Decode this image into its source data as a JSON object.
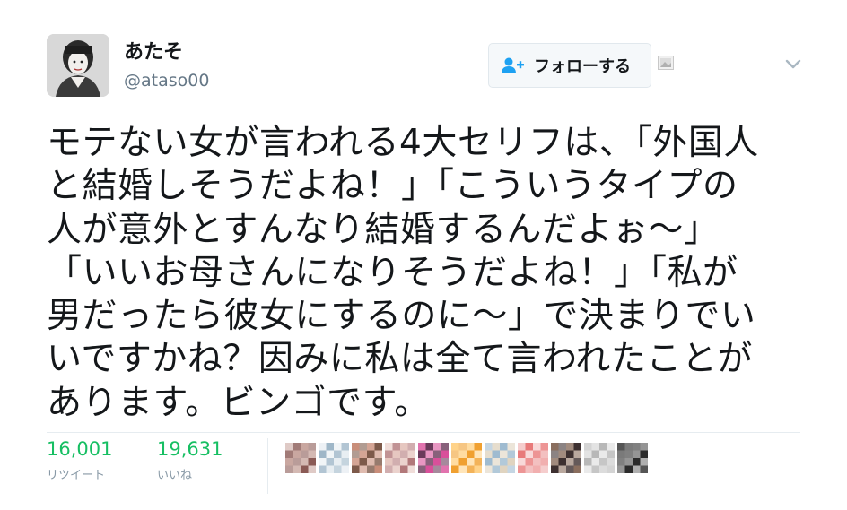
{
  "tweet": {
    "author_name": "あたそ",
    "author_handle": "@ataso00",
    "follow_label": "フォローする",
    "text": "モテない女が言われる4大セリフは、「外国人\nと結婚しそうだよね！」「こういうタイプの\n人が意外とすんなり結婚するんだよぉ～」\n「いいお母さんになりそうだよね！」「私が\n男だったら彼女にするのに～」で決まりでい\nいですかね？因みに私は全て言われたことが\nあります。ビンゴです。"
  },
  "stats": {
    "retweets_value": "16,001",
    "retweets_label": "リツイート",
    "likes_value": "19,631",
    "likes_label": "いいね"
  },
  "icons": {
    "follow": "add-user-icon",
    "cache": "cached-image-icon",
    "menu": "chevron-down-icon"
  },
  "colors": {
    "stat_green": "#17bf63",
    "follow_icon_blue": "#1da1f2"
  },
  "liker_avatars": [
    {
      "c1": "#c9a7a0",
      "c2": "#8a5a55"
    },
    {
      "c1": "#9fb7c8",
      "c2": "#e8eef2"
    },
    {
      "c1": "#c98e7a",
      "c2": "#7d5a4a"
    },
    {
      "c1": "#b2787a",
      "c2": "#e6c7c0"
    },
    {
      "c1": "#d9509a",
      "c2": "#6a3a5a"
    },
    {
      "c1": "#f0a030",
      "c2": "#ffd38a"
    },
    {
      "c1": "#9fbbd0",
      "c2": "#e0d4c0"
    },
    {
      "c1": "#e87a7a",
      "c2": "#f3c0c0"
    },
    {
      "c1": "#8a6e5e",
      "c2": "#3d3030"
    },
    {
      "c1": "#dcdcdc",
      "c2": "#b8b8b8"
    },
    {
      "c1": "#2b2b2b",
      "c2": "#7a7a7a"
    }
  ]
}
